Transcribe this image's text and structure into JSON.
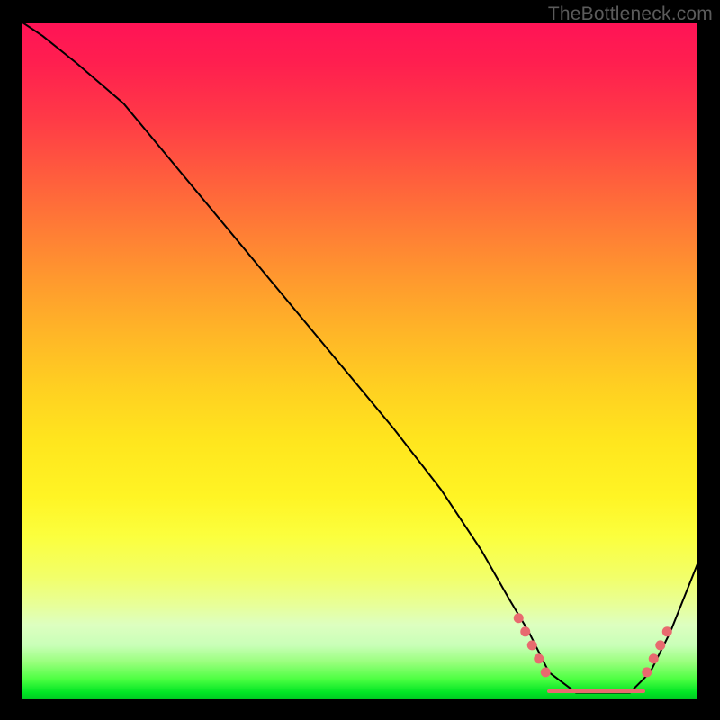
{
  "watermark": "TheBottleneck.com",
  "chart_data": {
    "type": "line",
    "title": "",
    "xlabel": "",
    "ylabel": "",
    "xlim": [
      0,
      100
    ],
    "ylim": [
      0,
      100
    ],
    "curve": {
      "x": [
        0,
        3,
        8,
        15,
        25,
        35,
        45,
        55,
        62,
        68,
        72,
        75,
        78,
        82,
        86,
        90,
        93,
        96,
        100
      ],
      "y": [
        100,
        98,
        94,
        88,
        76,
        64,
        52,
        40,
        31,
        22,
        15,
        10,
        4,
        1,
        1,
        1,
        4,
        10,
        20
      ]
    },
    "markers_left": [
      [
        73.5,
        12
      ],
      [
        74.5,
        10
      ],
      [
        75.5,
        8
      ],
      [
        76.5,
        6
      ],
      [
        77.5,
        4
      ]
    ],
    "markers_right": [
      [
        92.5,
        4
      ],
      [
        93.5,
        6
      ],
      [
        94.5,
        8
      ],
      [
        95.5,
        10
      ]
    ],
    "flat_segment": {
      "x0": 78,
      "x1": 92,
      "y": 1.2
    },
    "colors": {
      "curve": "#000000",
      "marker": "#e86a6f",
      "gradient_top": "#ff1356",
      "gradient_bottom": "#00c722"
    }
  }
}
